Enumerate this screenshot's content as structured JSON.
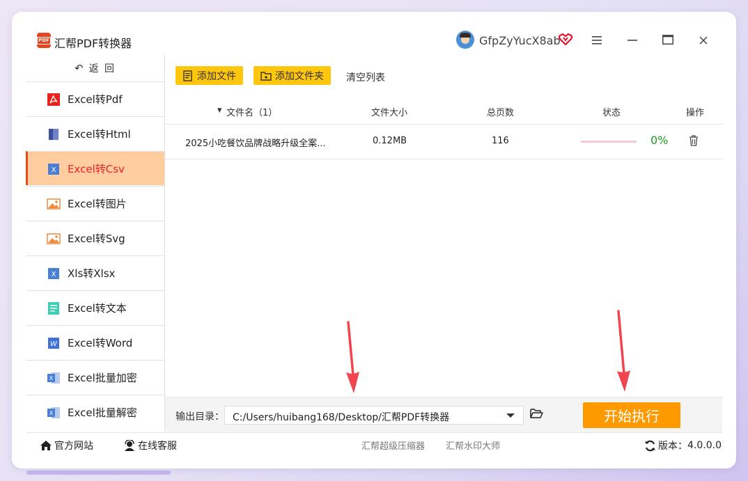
{
  "app": {
    "title": "汇帮PDF转换器",
    "logo_text": "PDF",
    "username": "GfpZyYucX8ab"
  },
  "sidebar": {
    "back_label": "返 回",
    "items": [
      {
        "label": "Excel转Pdf",
        "icon": "pdf-icon",
        "active": false
      },
      {
        "label": "Excel转Html",
        "icon": "html-icon",
        "active": false
      },
      {
        "label": "Excel转Csv",
        "icon": "csv-icon",
        "active": true
      },
      {
        "label": "Excel转图片",
        "icon": "image-icon",
        "active": false
      },
      {
        "label": "Excel转Svg",
        "icon": "svg-icon",
        "active": false
      },
      {
        "label": "Xls转Xlsx",
        "icon": "xlsx-icon",
        "active": false
      },
      {
        "label": "Excel转文本",
        "icon": "text-icon",
        "active": false
      },
      {
        "label": "Excel转Word",
        "icon": "word-icon",
        "active": false
      },
      {
        "label": "Excel批量加密",
        "icon": "excel-encrypt-icon",
        "active": false
      },
      {
        "label": "Excel批量解密",
        "icon": "excel-decrypt-icon",
        "active": false
      }
    ]
  },
  "toolbar": {
    "add_file": "添加文件",
    "add_folder": "添加文件夹",
    "clear_list": "清空列表"
  },
  "table": {
    "headers": {
      "name": "文件名（1）",
      "size": "文件大小",
      "pages": "总页数",
      "status": "状态",
      "action": "操作"
    },
    "rows": [
      {
        "name": "2025小吃餐饮品牌战略升级全案...",
        "size": "0.12MB",
        "pages": "116",
        "progress": 0,
        "percent": "0%"
      }
    ]
  },
  "output": {
    "label": "输出目录：",
    "path": "C:/Users/huibang168/Desktop/汇帮PDF转换器",
    "start_label": "开始执行"
  },
  "footer": {
    "website": "官方网站",
    "service": "在线客服",
    "compress": "汇帮超级压缩器",
    "watermark": "汇帮水印大师",
    "version_label": "版本：",
    "version": "4.0.0.0"
  },
  "colors": {
    "accent_orange": "#ff9900",
    "button_yellow": "#ffc60f",
    "active_bg": "#ffcda0",
    "active_text": "#ee2222",
    "progress_text": "#1aa01a"
  }
}
